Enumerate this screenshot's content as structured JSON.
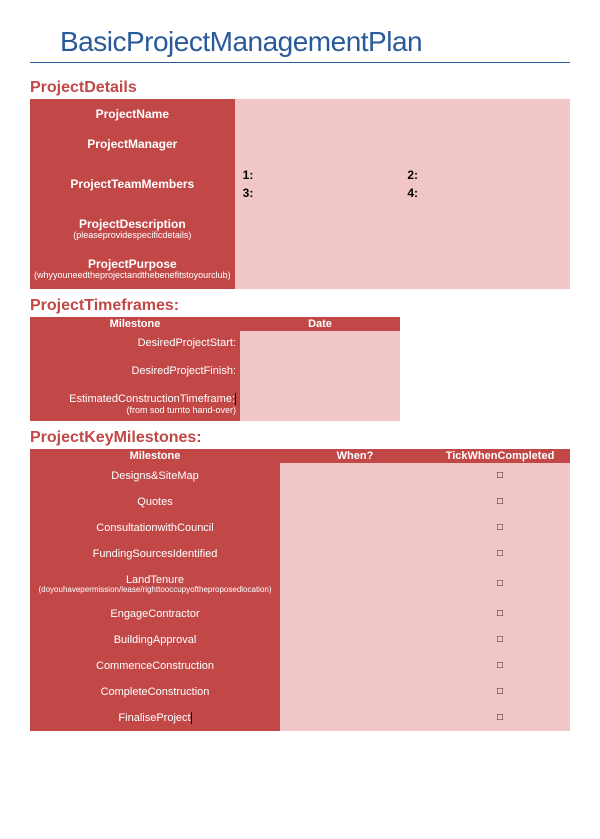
{
  "title": "BasicProjectManagementPlan",
  "sections": {
    "details_heading": "ProjectDetails",
    "timeframes_heading": "ProjectTimeframes:",
    "milestones_heading": "ProjectKeyMilestones:"
  },
  "details": {
    "rows": [
      {
        "label": "ProjectName",
        "sub": ""
      },
      {
        "label": "ProjectManager",
        "sub": ""
      },
      {
        "label": "ProjectTeamMembers",
        "sub": ""
      },
      {
        "label": "ProjectDescription",
        "sub": "(pleaseprovidespecificdetails)"
      },
      {
        "label": "ProjectPurpose",
        "sub": "(whyyouneedtheprojectandthebenefitstoyourclub)"
      }
    ],
    "team": {
      "m1": "1:",
      "m2": "2:",
      "m3": "3:",
      "m4": "4:"
    }
  },
  "timeframes": {
    "headers": {
      "milestone": "Milestone",
      "date": "Date"
    },
    "rows": [
      {
        "label": "DesiredProjectStart:",
        "sub": ""
      },
      {
        "label": "DesiredProjectFinish:",
        "sub": ""
      },
      {
        "label": "EstimatedConstructionTimeframe:",
        "sub": "(from sod turnto hand-over)"
      }
    ]
  },
  "milestones": {
    "headers": {
      "milestone": "Milestone",
      "when": "When?",
      "tick": "TickWhenCompleted"
    },
    "rows": [
      {
        "label": "Designs&SiteMap",
        "sub": "",
        "tick": "□"
      },
      {
        "label": "Quotes",
        "sub": "",
        "tick": "□"
      },
      {
        "label": "ConsultationwithCouncil",
        "sub": "",
        "tick": "□"
      },
      {
        "label": "FundingSourcesIdentified",
        "sub": "",
        "tick": "□"
      },
      {
        "label": "LandTenure",
        "sub": "(doyouhavepermission/lease/righttooccupyoftheproposedlocation)",
        "tick": "□"
      },
      {
        "label": "EngageContractor",
        "sub": "",
        "tick": "□"
      },
      {
        "label": "BuildingApproval",
        "sub": "",
        "tick": "□"
      },
      {
        "label": "CommenceConstruction",
        "sub": "",
        "tick": "□"
      },
      {
        "label": "CompleteConstruction",
        "sub": "",
        "tick": "□"
      },
      {
        "label": "FinaliseProject",
        "sub": "",
        "tick": "□"
      }
    ]
  }
}
